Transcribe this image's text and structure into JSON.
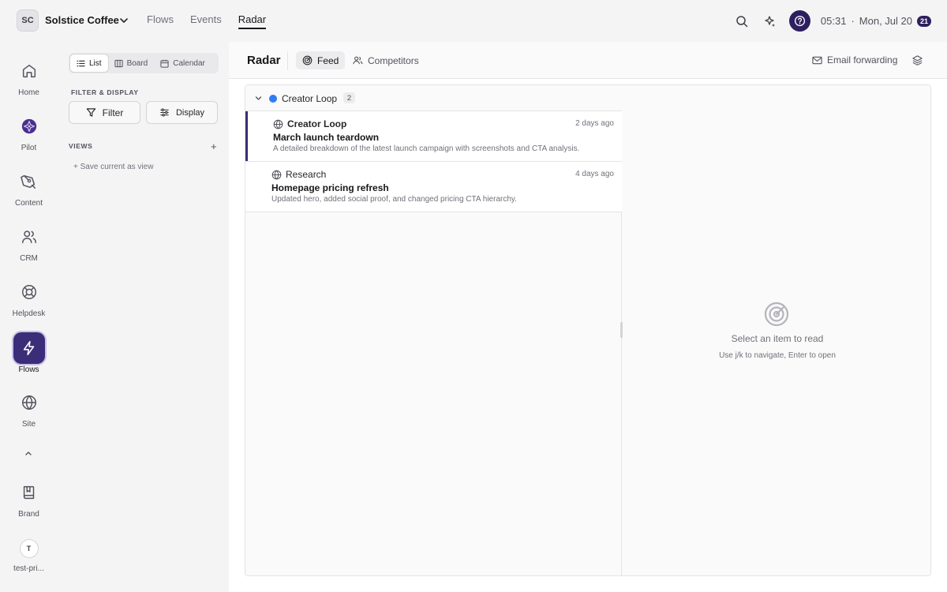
{
  "workspace": {
    "initials": "SC",
    "name": "Solstice Coffee"
  },
  "topnav": [
    {
      "label": "Flows",
      "active": false
    },
    {
      "label": "Events",
      "active": false
    },
    {
      "label": "Radar",
      "active": true
    }
  ],
  "topbar": {
    "time": "05:31",
    "separator": "·",
    "date": "Mon, Jul 20",
    "date_badge": "21"
  },
  "rail": {
    "items": [
      {
        "label": "Home",
        "icon": "home-icon"
      },
      {
        "label": "Pilot",
        "icon": "pilot-icon"
      },
      {
        "label": "Content",
        "icon": "pen-icon"
      },
      {
        "label": "CRM",
        "icon": "users-icon"
      },
      {
        "label": "Helpdesk",
        "icon": "lifebuoy-icon"
      },
      {
        "label": "Flows",
        "icon": "bolt-icon",
        "active": true
      },
      {
        "label": "Site",
        "icon": "globe-icon"
      }
    ],
    "bottom": [
      {
        "label": "Brand",
        "icon": "book-icon"
      },
      {
        "label": "test-pri...",
        "avatar": "T"
      }
    ]
  },
  "sidebar": {
    "view_tabs": [
      {
        "label": "List",
        "active": true
      },
      {
        "label": "Board",
        "active": false
      },
      {
        "label": "Calendar",
        "active": false
      }
    ],
    "filter_section": "FILTER & DISPLAY",
    "filter_label": "Filter",
    "display_label": "Display",
    "views_section": "VIEWS",
    "views_add": "+",
    "save_view": "+ Save current as view"
  },
  "main": {
    "title": "Radar",
    "tabs": [
      {
        "label": "Feed",
        "active": true
      },
      {
        "label": "Competitors",
        "active": false
      }
    ],
    "email_forwarding": "Email forwarding"
  },
  "feed": {
    "group": {
      "name": "Creator Loop",
      "count": "2",
      "color": "#2f7cf6"
    },
    "items": [
      {
        "source": "Creator Loop",
        "time": "2 days ago",
        "title": "March launch teardown",
        "desc": "A detailed breakdown of the latest launch campaign with screenshots and CTA analysis.",
        "selected": true
      },
      {
        "source": "Research",
        "time": "4 days ago",
        "title": "Homepage pricing refresh",
        "desc": "Updated hero, added social proof, and changed pricing CTA hierarchy.",
        "selected": false
      }
    ]
  },
  "reader": {
    "empty_title": "Select an item to read",
    "empty_hint": "Use j/k to navigate, Enter to open"
  },
  "colors": {
    "accent": "#3b2d78",
    "help": "#2e1f5e",
    "group_dot": "#2f7cf6"
  }
}
